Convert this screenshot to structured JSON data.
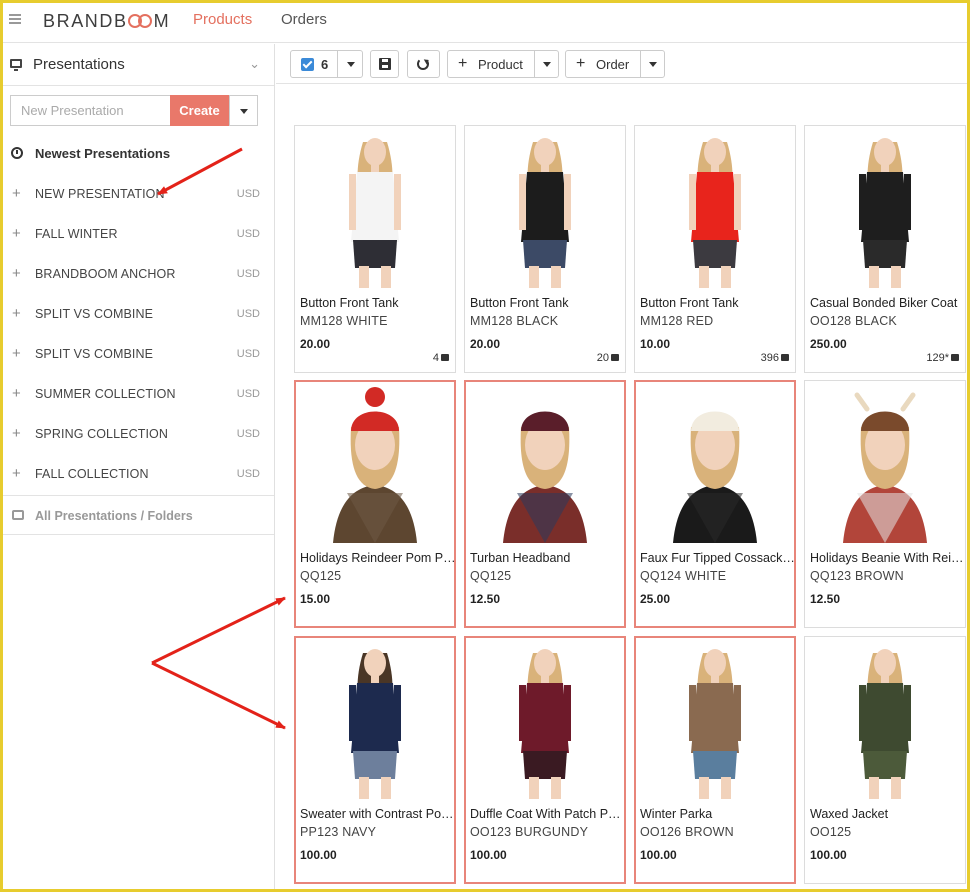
{
  "topbar": {
    "logo": "BRANDB",
    "logo_tail": "M",
    "tabs": [
      {
        "label": "Products",
        "active": true
      },
      {
        "label": "Orders",
        "active": false
      }
    ]
  },
  "sidebar": {
    "header": "Presentations",
    "new_presentation_placeholder": "New Presentation",
    "create_label": "Create",
    "newest_label": "Newest Presentations",
    "presentations": [
      {
        "name": "NEW PRESENTATION",
        "currency": "USD"
      },
      {
        "name": "FALL WINTER",
        "currency": "USD"
      },
      {
        "name": "BRANDBOOM ANCHOR",
        "currency": "USD"
      },
      {
        "name": "SPLIT VS COMBINE",
        "currency": "USD"
      },
      {
        "name": "SPLIT VS COMBINE",
        "currency": "USD"
      },
      {
        "name": "SUMMER COLLECTION",
        "currency": "USD"
      },
      {
        "name": "SPRING COLLECTION",
        "currency": "USD"
      },
      {
        "name": "FALL COLLECTION",
        "currency": "USD"
      }
    ],
    "all_label": "All Presentations / Folders"
  },
  "toolbar": {
    "selected_count": "6",
    "product_label": "Product",
    "order_label": "Order"
  },
  "products": [
    {
      "name": "Button Front Tank",
      "code": "MM128 WHITE",
      "price": "20.00",
      "stock": "4",
      "selected": false,
      "top_color": "#f4f4f4",
      "bottom_color": "#2e2e35",
      "hat_color": ""
    },
    {
      "name": "Button Front Tank",
      "code": "MM128 BLACK",
      "price": "20.00",
      "stock": "20",
      "selected": false,
      "top_color": "#1c1c1c",
      "bottom_color": "#3c4a66",
      "hat_color": ""
    },
    {
      "name": "Button Front Tank",
      "code": "MM128 RED",
      "price": "10.00",
      "stock": "396",
      "selected": false,
      "top_color": "#e8241c",
      "bottom_color": "#3c3a40",
      "hat_color": ""
    },
    {
      "name": "Casual Bonded Biker Coat",
      "code": "OO128 BLACK",
      "price": "250.00",
      "stock": "129*",
      "selected": false,
      "top_color": "#1e1e1e",
      "bottom_color": "#2a2a2a",
      "hat_color": ""
    },
    {
      "name": "Holidays Reindeer Pom Pom Beanie",
      "code": "QQ125",
      "price": "15.00",
      "stock": "",
      "selected": true,
      "top_color": "#5d4630",
      "bottom_color": "#6e5a45",
      "hat_color": "#d22a25"
    },
    {
      "name": "Turban Headband",
      "code": "QQ125",
      "price": "12.50",
      "stock": "",
      "selected": true,
      "top_color": "#7a2e2a",
      "bottom_color": "#2a3a5c",
      "hat_color": "#5a1e2a"
    },
    {
      "name": "Faux Fur Tipped Cossack Hat",
      "code": "QQ124 WHITE",
      "price": "25.00",
      "stock": "",
      "selected": true,
      "top_color": "#1a1a1a",
      "bottom_color": "#2a2a2a",
      "hat_color": "#f2ecdf"
    },
    {
      "name": "Holidays Beanie With Reindeer Ears",
      "code": "QQ123 BROWN",
      "price": "12.50",
      "stock": "",
      "selected": false,
      "top_color": "#b2453a",
      "bottom_color": "#e4e4e4",
      "hat_color": "#7a4a2c"
    },
    {
      "name": "Sweater with Contrast Pocket",
      "code": "PP123 NAVY",
      "price": "100.00",
      "stock": "",
      "selected": true,
      "top_color": "#1d2a4e",
      "bottom_color": "#6d7f9c",
      "hat_color": ""
    },
    {
      "name": "Duffle Coat With Patch Pockets",
      "code": "OO123 BURGUNDY",
      "price": "100.00",
      "stock": "",
      "selected": true,
      "top_color": "#6e1a2a",
      "bottom_color": "#3a1a22",
      "hat_color": ""
    },
    {
      "name": "Winter Parka",
      "code": "OO126 BROWN",
      "price": "100.00",
      "stock": "",
      "selected": true,
      "top_color": "#8a6a50",
      "bottom_color": "#5a7e9e",
      "hat_color": ""
    },
    {
      "name": "Waxed Jacket",
      "code": "OO125",
      "price": "100.00",
      "stock": "",
      "selected": false,
      "top_color": "#3e4a30",
      "bottom_color": "#4c5a3a",
      "hat_color": ""
    }
  ],
  "colors": {
    "accent": "#e4705f",
    "selection_border": "#e8857a",
    "checkbox": "#3b8ad8",
    "annotation_arrow": "#e32219",
    "frame": "#e7cc2e"
  }
}
